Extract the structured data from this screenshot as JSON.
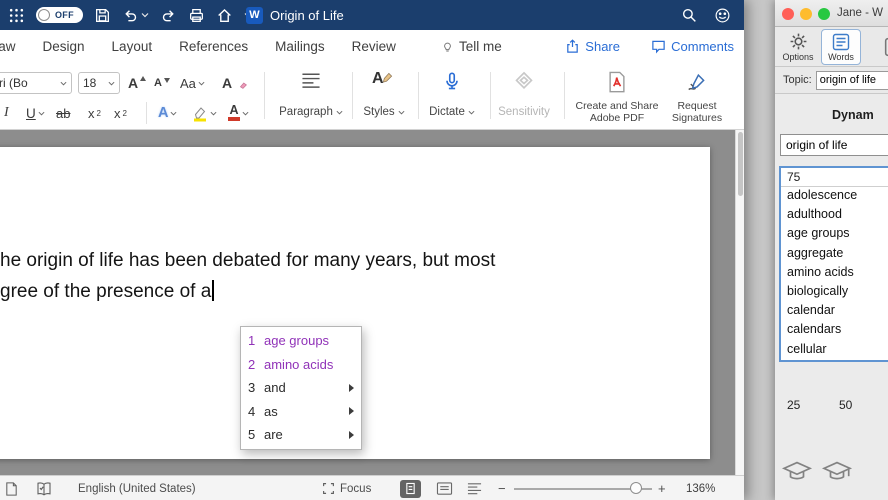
{
  "colors": {
    "titlebar": "#1b3e6d",
    "accent": "#2a6dd5",
    "word_icon": "#185abd",
    "prediction": "#9032b8",
    "highlight": "#f7e200",
    "font_red": "#d03a2a",
    "focus_border": "#5f94d2",
    "traffic_red": "#ff5f57",
    "traffic_yellow": "#febc2e",
    "traffic_green": "#28c841"
  },
  "word": {
    "titlebar": {
      "autosave": "OFF",
      "doc_badge": "W",
      "title": "Origin of Life"
    },
    "tabs": [
      {
        "label": "Draw"
      },
      {
        "label": "Design"
      },
      {
        "label": "Layout"
      },
      {
        "label": "References"
      },
      {
        "label": "Mailings"
      },
      {
        "label": "Review"
      }
    ],
    "tell_me": "Tell me",
    "share": "Share",
    "comments": "Comments",
    "ribbon": {
      "font_name": "ri (Bo",
      "font_size": "18",
      "grow_font": "A",
      "shrink_font": "A",
      "change_case": "Aa",
      "clear_format": "A",
      "italic": "I",
      "underline": "U",
      "strikethrough": "ab",
      "subscript_base": "x",
      "subscript_small": "2",
      "superscript_base": "x",
      "superscript_small": "2",
      "text_effects": "A",
      "font_color": "A",
      "paragraph": "Paragraph",
      "styles": "Styles",
      "styles_letter": "A",
      "dictate": "Dictate",
      "sensitivity": "Sensitivity",
      "adobe_line1": "Create and Share",
      "adobe_line2": "Adobe PDF",
      "sign_line1": "Request",
      "sign_line2": "Signatures"
    },
    "document": {
      "line1": "he origin of life has been debated for many years, but most",
      "line2": "gree of the presence of a"
    },
    "prediction": {
      "items": [
        {
          "num": "1",
          "word": "age groups"
        },
        {
          "num": "2",
          "word": "amino acids"
        },
        {
          "num": "3",
          "word": "and"
        },
        {
          "num": "4",
          "word": "as"
        },
        {
          "num": "5",
          "word": "are"
        }
      ]
    },
    "statusbar": {
      "language": "English (United States)",
      "focus": "Focus",
      "zoom_out": "−",
      "zoom_in": "+",
      "zoom_level": "136%"
    }
  },
  "panel": {
    "title": "Jane - W",
    "toolbar": {
      "options": "Options",
      "words": "Words"
    },
    "topic_label": "Topic:",
    "topic_value": "origin of life",
    "section_title": "Dynam",
    "search_value": "origin of life",
    "count": "75",
    "words": [
      "adolescence",
      "adulthood",
      "age groups",
      "aggregate",
      "amino acids",
      "biologically",
      "calendar",
      "calendars",
      "cellular"
    ],
    "ticks": [
      "25",
      "50"
    ]
  }
}
